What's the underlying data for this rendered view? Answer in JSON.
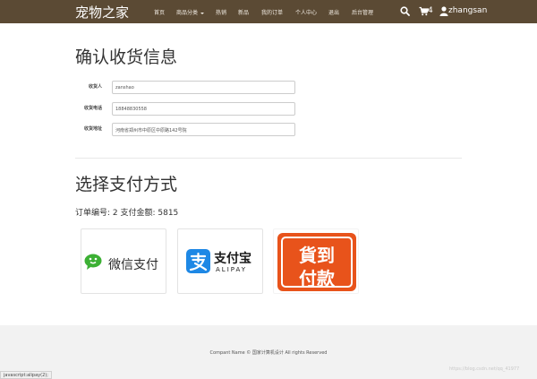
{
  "navbar": {
    "brand": "宠物之家",
    "items": [
      "首页",
      "商品分类",
      "热销",
      "新品",
      "我的订单",
      "个人中心",
      "退出",
      "后台管理"
    ],
    "cart_count": "4",
    "username": "zhangsan",
    "icons": [
      "search-icon",
      "cart-icon",
      "user-icon"
    ],
    "color": "#5b4a34"
  },
  "shipping": {
    "title": "确认收货信息",
    "fields": [
      {
        "label": "收货人",
        "value": "zanshao"
      },
      {
        "label": "收货电话",
        "value": "18848830558"
      },
      {
        "label": "收货地址",
        "value": "河南省郑州市中原区中原路142号院"
      }
    ]
  },
  "payment": {
    "title": "选择支付方式",
    "order_info": "订单编号: 2 支付金额: 5815",
    "options": [
      {
        "name": "微信支付",
        "icon": "wechat-icon",
        "color": "#3cb034"
      },
      {
        "name": "支付宝",
        "sub": "ALIPAY",
        "icon": "alipay-icon",
        "color": "#1e88e5"
      },
      {
        "line1": "貨到",
        "line2": "付款",
        "color": "#e8531b"
      }
    ]
  },
  "footer": {
    "text": "Compant Name © 国家计算机设计 All rights Reserved"
  },
  "status_bar": {
    "link": "javascript:alipay(2);"
  },
  "watermark": "https://blog.csdn.net/qq_41977"
}
